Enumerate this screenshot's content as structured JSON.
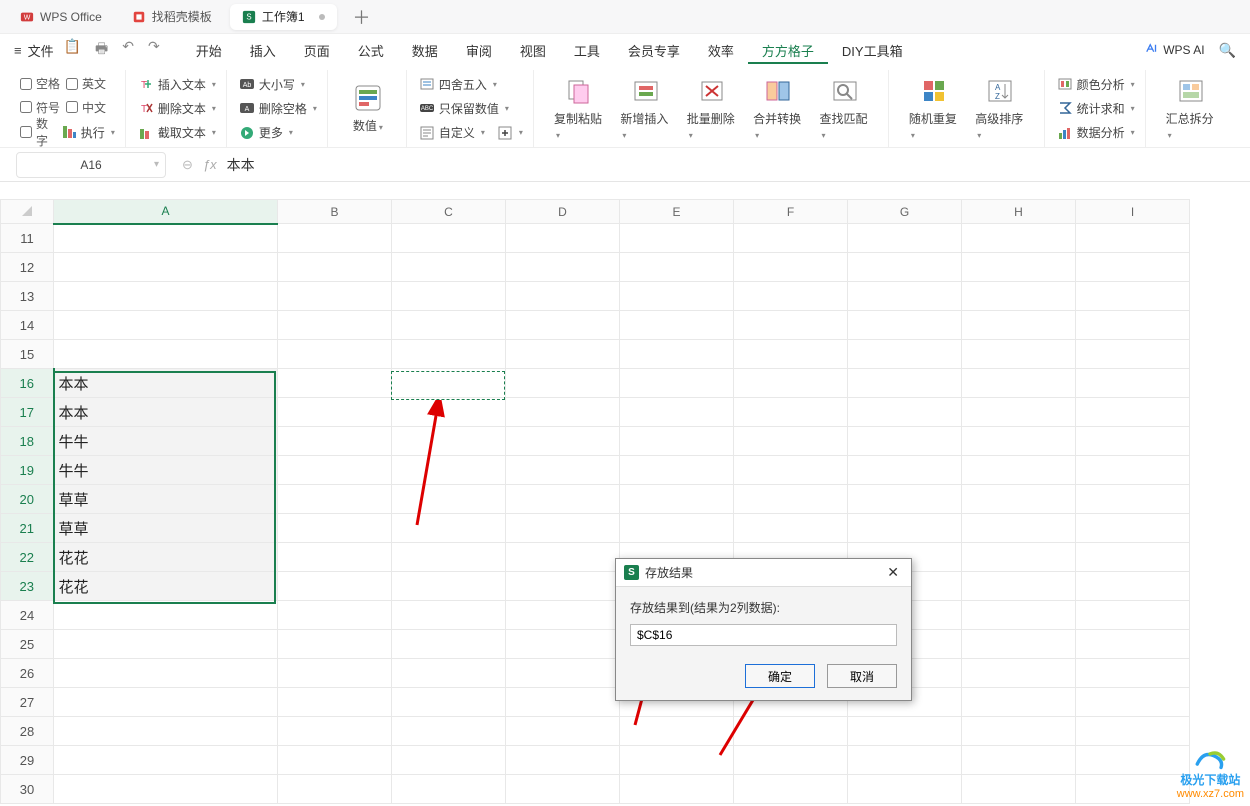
{
  "titlebar": {
    "tabs": [
      {
        "label": "WPS Office"
      },
      {
        "label": "找稻壳模板"
      },
      {
        "label": "工作簿1"
      }
    ]
  },
  "menubar": {
    "file": "文件",
    "items": [
      "开始",
      "插入",
      "页面",
      "公式",
      "数据",
      "审阅",
      "视图",
      "工具",
      "会员专享",
      "效率",
      "方方格子",
      "DIY工具箱"
    ],
    "active": "方方格子",
    "wps_ai": "WPS AI"
  },
  "ribbon": {
    "g1": {
      "blank": "空格",
      "eng": "英文",
      "sym": "符号",
      "chs": "中文",
      "num": "数字",
      "run": "执行"
    },
    "g2": {
      "instext": "插入文本",
      "deltext": "删除文本",
      "cuttext": "截取文本"
    },
    "g3": {
      "case": "大小写",
      "delblank": "删除空格",
      "more": "更多"
    },
    "g4": {
      "value": "数值"
    },
    "g5": {
      "round": "四舍五入",
      "onlyval": "只保留数值",
      "custom": "自定义"
    },
    "g6": {
      "copypaste": "复制粘贴",
      "newins": "新增插入",
      "batchdel": "批量删除",
      "mergeconv": "合并转换",
      "findmatch": "查找匹配"
    },
    "g7": {
      "randrep": "随机重复",
      "advsort": "高级排序"
    },
    "g8": {
      "coloranal": "颜色分析",
      "statsums": "统计求和",
      "dataanal": "数据分析"
    },
    "g9": {
      "summary": "汇总拆分"
    }
  },
  "namebox": {
    "ref": "A16"
  },
  "formula": {
    "value": "本本"
  },
  "sheet": {
    "columns": [
      "A",
      "B",
      "C",
      "D",
      "E",
      "F",
      "G",
      "H",
      "I"
    ],
    "rows": [
      11,
      12,
      13,
      14,
      15,
      16,
      17,
      18,
      19,
      20,
      21,
      22,
      23,
      24,
      25,
      26,
      27,
      28,
      29,
      30
    ],
    "dataA": {
      "16": "本本",
      "17": "本本",
      "18": "牛牛",
      "19": "牛牛",
      "20": "草草",
      "21": "草草",
      "22": "花花",
      "23": "花花"
    }
  },
  "dialog": {
    "title": "存放结果",
    "label": "存放结果到(结果为2列数据):",
    "value": "$C$16",
    "ok": "确定",
    "cancel": "取消"
  },
  "watermark": {
    "line1": "极光下载站",
    "line2": "www.xz7.com"
  }
}
